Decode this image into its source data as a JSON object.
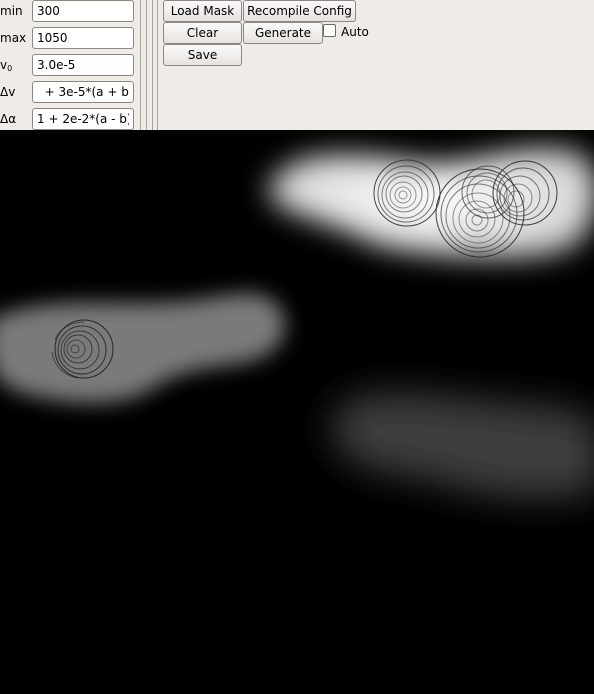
{
  "params": [
    {
      "label": "min",
      "sub": "",
      "value": "300"
    },
    {
      "label": "max",
      "sub": "",
      "value": "1050"
    },
    {
      "label": "v",
      "sub": "0",
      "value": "3.0e-5"
    },
    {
      "label": "Δv",
      "sub": "",
      "value": "  + 3e-5*(a + b)"
    },
    {
      "label": "Δα",
      "sub": "",
      "value": "1 + 2e-2*(a - b)"
    }
  ],
  "toolbar": {
    "load_mask": "Load Mask",
    "recompile_config": "Recompile Config",
    "clear": "Clear",
    "generate": "Generate",
    "save": "Save",
    "auto_label": "Auto",
    "auto_checked": false
  }
}
